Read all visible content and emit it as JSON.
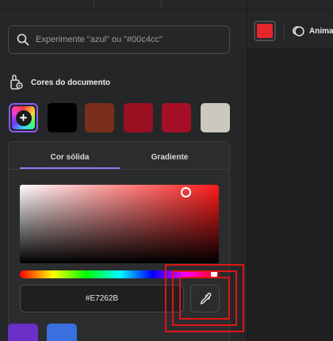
{
  "search": {
    "placeholder": "Experimente \"azul\" ou \"#00c4cc\""
  },
  "document_colors": {
    "title": "Cores do documento",
    "icon": "palette-icon",
    "add_icon": "plus-icon",
    "swatches": [
      "#000000",
      "#7a2f1a",
      "#9a0f22",
      "#a50f25",
      "#cbc8bd"
    ]
  },
  "color_picker": {
    "tabs": [
      {
        "label": "Cor sólida",
        "active": true
      },
      {
        "label": "Gradiente",
        "active": false
      }
    ],
    "hex_value": "#E7262B",
    "eyedropper_icon": "eyedropper-icon",
    "hue_color": "#ff1a1a"
  },
  "bottom_swatches": [
    "#6a2fc7",
    "#3a6fe0"
  ],
  "toolbar": {
    "current_color": "#e7262b",
    "animate_label": "Anima",
    "animate_icon": "animate-icon"
  },
  "colors": {
    "accent": "#8b5cf6",
    "highlight": "#e11414"
  }
}
